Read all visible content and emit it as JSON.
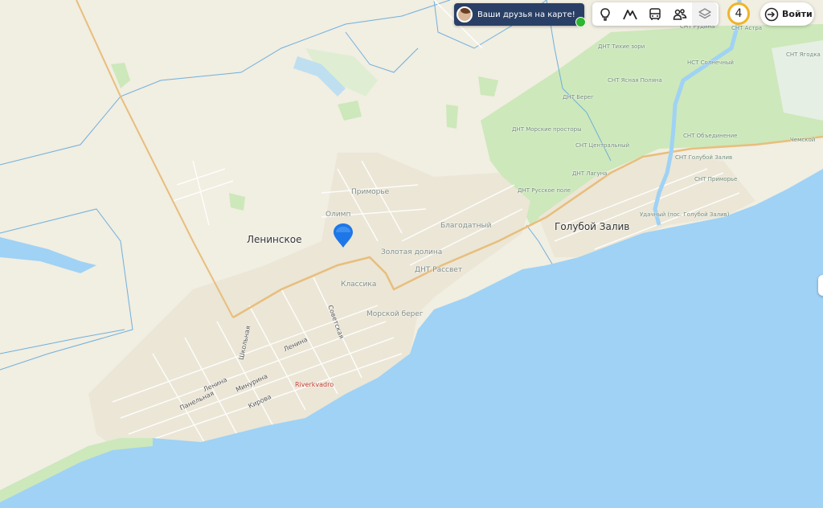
{
  "promo": {
    "text": "Ваши друзья на карте!"
  },
  "toolbar": {
    "items": [
      {
        "icon": "tree-icon"
      },
      {
        "icon": "mountains-icon"
      },
      {
        "icon": "bus-icon"
      },
      {
        "icon": "people-icon"
      },
      {
        "icon": "layers-icon"
      }
    ]
  },
  "badge": {
    "count": "4"
  },
  "login": {
    "label": "Войти"
  },
  "colors": {
    "water": "#9fd2f5",
    "land": "#f1eee2",
    "forest": "#cde8ba",
    "road": "#e8be7c",
    "border": "#5aa5d6",
    "accent": "#f0b429",
    "pin": "#1e77e8"
  },
  "map": {
    "places": {
      "leninskoe": "Ленинское",
      "goluboy_zaliv": "Голубой Залив",
      "primorye": "Приморье",
      "olimp": "Олимп",
      "blagodatny": "Благодатный",
      "zolotaya_dolina": "Золотая долина",
      "dnt_rassvet": "ДНТ Рассвет",
      "klassika": "Классика",
      "morskoy_bereg": "Морской берег"
    },
    "streets": {
      "shkolnaya": "Школьная",
      "sovetskaya": "Советская",
      "lenina_1": "Ленина",
      "lenina_2": "Ленина",
      "minyurina": "Минурина",
      "panelnaya": "Панельная",
      "kirova": "Кирова"
    },
    "poi": {
      "riverkvadro": "Riverkvadro"
    },
    "snt": {
      "rudina": "СНТ Рудина",
      "astra": "СНТ Астра",
      "tikhie_zori": "ДНТ Тихие зори",
      "solnechny": "НСТ Солнечный",
      "yagodka": "СНТ Ягодка",
      "yasnaya_polyana": "СНТ Ясная Поляна",
      "bereg": "ДНТ Берег",
      "morskie_prostory": "ДНТ Морские просторы",
      "obedinenie": "СНТ Объединение",
      "tsentralny": "СНТ Центральный",
      "goluboy_zaliv": "СНТ Голубой Залив",
      "laguna": "ДНТ Лагуна",
      "russkoe_pole": "ДНТ Русское поле",
      "primorye": "СНТ Приморье",
      "udachny": "Удачный (пос. Голубой Залив)",
      "chemsk": "Чемской"
    }
  }
}
